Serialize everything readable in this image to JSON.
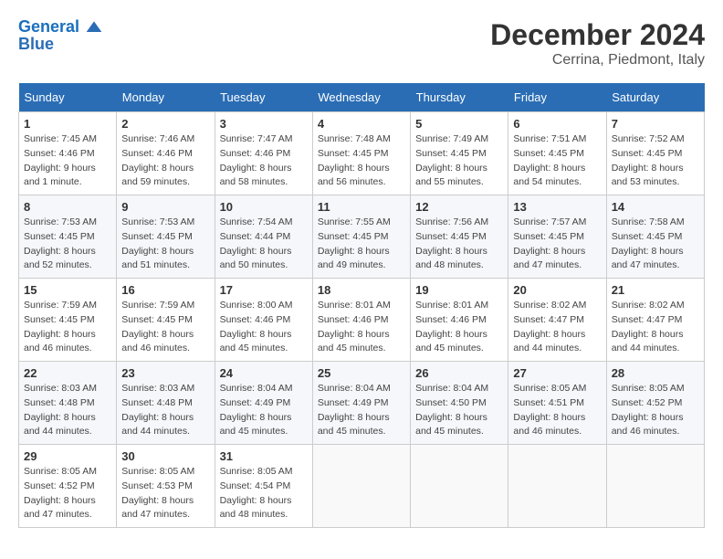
{
  "header": {
    "logo_line1": "General",
    "logo_line2": "Blue",
    "month": "December 2024",
    "location": "Cerrina, Piedmont, Italy"
  },
  "weekdays": [
    "Sunday",
    "Monday",
    "Tuesday",
    "Wednesday",
    "Thursday",
    "Friday",
    "Saturday"
  ],
  "weeks": [
    [
      {
        "day": "1",
        "info": "Sunrise: 7:45 AM\nSunset: 4:46 PM\nDaylight: 9 hours\nand 1 minute."
      },
      {
        "day": "2",
        "info": "Sunrise: 7:46 AM\nSunset: 4:46 PM\nDaylight: 8 hours\nand 59 minutes."
      },
      {
        "day": "3",
        "info": "Sunrise: 7:47 AM\nSunset: 4:46 PM\nDaylight: 8 hours\nand 58 minutes."
      },
      {
        "day": "4",
        "info": "Sunrise: 7:48 AM\nSunset: 4:45 PM\nDaylight: 8 hours\nand 56 minutes."
      },
      {
        "day": "5",
        "info": "Sunrise: 7:49 AM\nSunset: 4:45 PM\nDaylight: 8 hours\nand 55 minutes."
      },
      {
        "day": "6",
        "info": "Sunrise: 7:51 AM\nSunset: 4:45 PM\nDaylight: 8 hours\nand 54 minutes."
      },
      {
        "day": "7",
        "info": "Sunrise: 7:52 AM\nSunset: 4:45 PM\nDaylight: 8 hours\nand 53 minutes."
      }
    ],
    [
      {
        "day": "8",
        "info": "Sunrise: 7:53 AM\nSunset: 4:45 PM\nDaylight: 8 hours\nand 52 minutes."
      },
      {
        "day": "9",
        "info": "Sunrise: 7:53 AM\nSunset: 4:45 PM\nDaylight: 8 hours\nand 51 minutes."
      },
      {
        "day": "10",
        "info": "Sunrise: 7:54 AM\nSunset: 4:44 PM\nDaylight: 8 hours\nand 50 minutes."
      },
      {
        "day": "11",
        "info": "Sunrise: 7:55 AM\nSunset: 4:45 PM\nDaylight: 8 hours\nand 49 minutes."
      },
      {
        "day": "12",
        "info": "Sunrise: 7:56 AM\nSunset: 4:45 PM\nDaylight: 8 hours\nand 48 minutes."
      },
      {
        "day": "13",
        "info": "Sunrise: 7:57 AM\nSunset: 4:45 PM\nDaylight: 8 hours\nand 47 minutes."
      },
      {
        "day": "14",
        "info": "Sunrise: 7:58 AM\nSunset: 4:45 PM\nDaylight: 8 hours\nand 47 minutes."
      }
    ],
    [
      {
        "day": "15",
        "info": "Sunrise: 7:59 AM\nSunset: 4:45 PM\nDaylight: 8 hours\nand 46 minutes."
      },
      {
        "day": "16",
        "info": "Sunrise: 7:59 AM\nSunset: 4:45 PM\nDaylight: 8 hours\nand 46 minutes."
      },
      {
        "day": "17",
        "info": "Sunrise: 8:00 AM\nSunset: 4:46 PM\nDaylight: 8 hours\nand 45 minutes."
      },
      {
        "day": "18",
        "info": "Sunrise: 8:01 AM\nSunset: 4:46 PM\nDaylight: 8 hours\nand 45 minutes."
      },
      {
        "day": "19",
        "info": "Sunrise: 8:01 AM\nSunset: 4:46 PM\nDaylight: 8 hours\nand 45 minutes."
      },
      {
        "day": "20",
        "info": "Sunrise: 8:02 AM\nSunset: 4:47 PM\nDaylight: 8 hours\nand 44 minutes."
      },
      {
        "day": "21",
        "info": "Sunrise: 8:02 AM\nSunset: 4:47 PM\nDaylight: 8 hours\nand 44 minutes."
      }
    ],
    [
      {
        "day": "22",
        "info": "Sunrise: 8:03 AM\nSunset: 4:48 PM\nDaylight: 8 hours\nand 44 minutes."
      },
      {
        "day": "23",
        "info": "Sunrise: 8:03 AM\nSunset: 4:48 PM\nDaylight: 8 hours\nand 44 minutes."
      },
      {
        "day": "24",
        "info": "Sunrise: 8:04 AM\nSunset: 4:49 PM\nDaylight: 8 hours\nand 45 minutes."
      },
      {
        "day": "25",
        "info": "Sunrise: 8:04 AM\nSunset: 4:49 PM\nDaylight: 8 hours\nand 45 minutes."
      },
      {
        "day": "26",
        "info": "Sunrise: 8:04 AM\nSunset: 4:50 PM\nDaylight: 8 hours\nand 45 minutes."
      },
      {
        "day": "27",
        "info": "Sunrise: 8:05 AM\nSunset: 4:51 PM\nDaylight: 8 hours\nand 46 minutes."
      },
      {
        "day": "28",
        "info": "Sunrise: 8:05 AM\nSunset: 4:52 PM\nDaylight: 8 hours\nand 46 minutes."
      }
    ],
    [
      {
        "day": "29",
        "info": "Sunrise: 8:05 AM\nSunset: 4:52 PM\nDaylight: 8 hours\nand 47 minutes."
      },
      {
        "day": "30",
        "info": "Sunrise: 8:05 AM\nSunset: 4:53 PM\nDaylight: 8 hours\nand 47 minutes."
      },
      {
        "day": "31",
        "info": "Sunrise: 8:05 AM\nSunset: 4:54 PM\nDaylight: 8 hours\nand 48 minutes."
      },
      {
        "day": "",
        "info": ""
      },
      {
        "day": "",
        "info": ""
      },
      {
        "day": "",
        "info": ""
      },
      {
        "day": "",
        "info": ""
      }
    ]
  ]
}
